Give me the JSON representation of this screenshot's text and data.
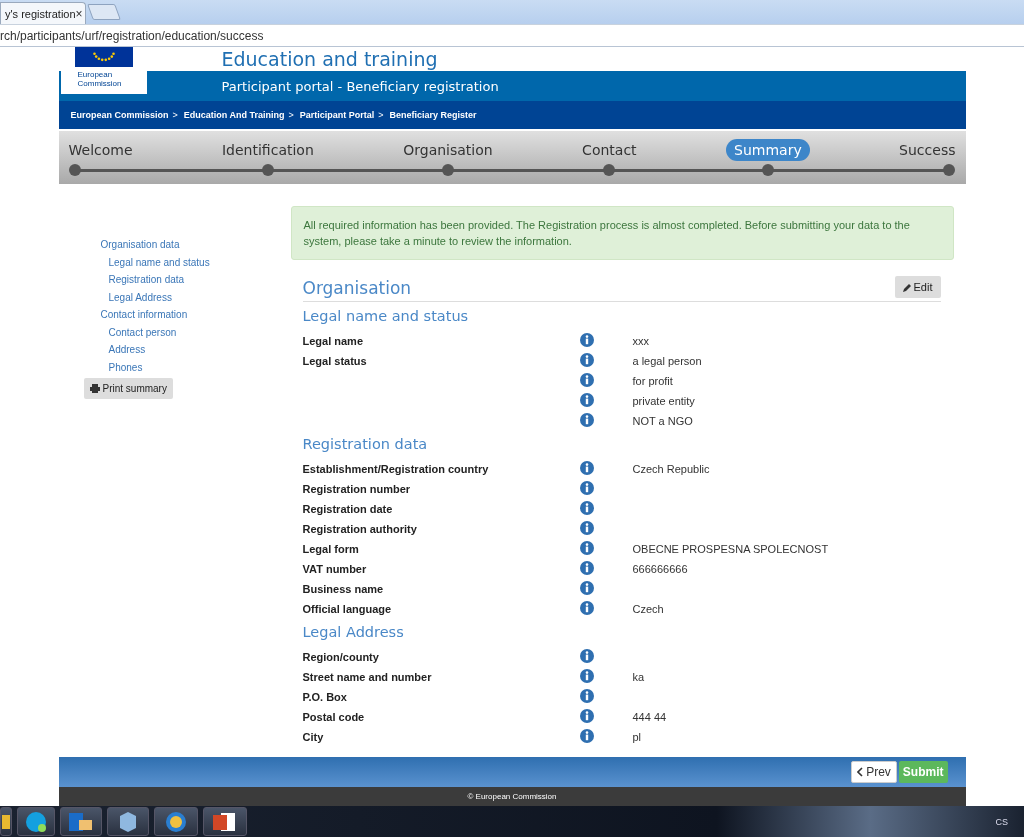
{
  "browser": {
    "tab_title": "y's registration",
    "tab_close": "×",
    "url": "rch/participants/urf/registration/education/success"
  },
  "header": {
    "title": "Education and training",
    "subtitle": "Participant portal - Beneficiary registration",
    "logo_text": "European Commission"
  },
  "breadcrumb": {
    "separator": ">",
    "items": [
      "European Commission",
      "Education And Training",
      "Participant Portal",
      "Beneficiary Register"
    ]
  },
  "steps": [
    {
      "label": "Welcome",
      "selected": false
    },
    {
      "label": "Identification",
      "selected": false
    },
    {
      "label": "Organisation",
      "selected": false
    },
    {
      "label": "Contact",
      "selected": false
    },
    {
      "label": "Summary",
      "selected": true
    },
    {
      "label": "Success",
      "selected": false
    }
  ],
  "sidebar": {
    "items": [
      {
        "label": "Organisation data",
        "children": [
          {
            "label": "Legal name and status"
          },
          {
            "label": "Registration data"
          },
          {
            "label": "Legal Address"
          }
        ]
      },
      {
        "label": "Contact information",
        "children": [
          {
            "label": "Contact person"
          },
          {
            "label": "Address"
          },
          {
            "label": "Phones"
          }
        ]
      }
    ],
    "print_button": "Print summary"
  },
  "alert": "All required information has been provided. The Registration process is almost completed. Before submitting your data to the system, please take a minute to review the information.",
  "section": {
    "title": "Organisation",
    "edit_button": "Edit",
    "groups": [
      {
        "title": "Legal name and status",
        "rows": [
          {
            "label": "Legal name",
            "value": "xxx"
          },
          {
            "label": "Legal status",
            "value": "a legal person"
          },
          {
            "value": "for profit"
          },
          {
            "value": "private entity"
          },
          {
            "value": "NOT a NGO"
          }
        ]
      },
      {
        "title": "Registration data",
        "rows": [
          {
            "label": "Establishment/Registration country",
            "value": "Czech Republic"
          },
          {
            "label": "Registration number"
          },
          {
            "label": "Registration date"
          },
          {
            "label": "Registration authority"
          },
          {
            "label": "Legal form",
            "value": "OBECNE PROSPESNA SPOLECNOST"
          },
          {
            "label": "VAT number",
            "value": "666666666"
          },
          {
            "label": "Business name"
          },
          {
            "label": "Official language",
            "value": "Czech"
          }
        ]
      },
      {
        "title": "Legal Address",
        "rows": [
          {
            "label": "Region/county"
          },
          {
            "label": "Street name and number",
            "value": "ka"
          },
          {
            "label": "P.O. Box"
          },
          {
            "label": "Postal code",
            "value": "444 44"
          },
          {
            "label": "City",
            "value": "pl"
          }
        ]
      }
    ]
  },
  "footer": {
    "prev_button": "Prev",
    "submit_button": "Submit",
    "copyright": "© European Commission"
  },
  "taskbar": {
    "language": "CS"
  }
}
